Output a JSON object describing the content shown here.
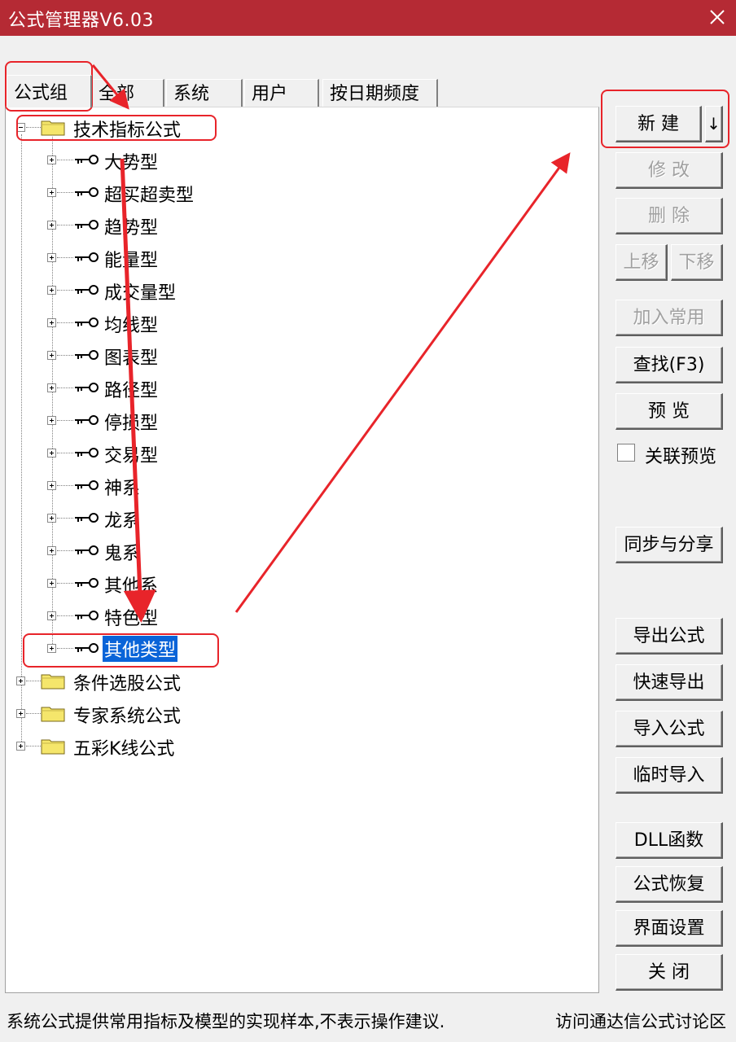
{
  "window": {
    "title": "公式管理器V6.03"
  },
  "tabs": [
    "公式组",
    "全部",
    "系统",
    "用户",
    "按日期频度"
  ],
  "tree": {
    "root_open": "技术指标公式",
    "children": [
      "大势型",
      "超买超卖型",
      "趋势型",
      "能量型",
      "成交量型",
      "均线型",
      "图表型",
      "路径型",
      "停损型",
      "交易型",
      "神系",
      "龙系",
      "鬼系",
      "其他系",
      "特色型",
      "其他类型"
    ],
    "selected_child": "其他类型",
    "roots_closed": [
      "条件选股公式",
      "专家系统公式",
      "五彩K线公式"
    ]
  },
  "buttons": {
    "new": "新 建",
    "new_arrow": "↓",
    "modify": "修 改",
    "delete": "删 除",
    "move_up": "上移",
    "move_down": "下移",
    "add_common": "加入常用",
    "find": "查找(F3)",
    "preview": "预 览",
    "link_preview_label": "关联预览",
    "sync_share": "同步与分享",
    "export": "导出公式",
    "quick_export": "快速导出",
    "import": "导入公式",
    "temp_import": "临时导入",
    "dll": "DLL函数",
    "restore": "公式恢复",
    "ui_settings": "界面设置",
    "close": "关 闭"
  },
  "link_preview_checked": false,
  "status": {
    "left": "系统公式提供常用指标及模型的实现样本,不表示操作建议.",
    "right": "访问通达信公式讨论区"
  },
  "colors": {
    "titlebar": "#b52a34",
    "selection": "#0a64d8",
    "annotation": "#e8242a",
    "folder": "#f5e66b"
  },
  "icons": {
    "close": "close-icon",
    "folder": "folder-icon",
    "formula": "key-icon"
  }
}
